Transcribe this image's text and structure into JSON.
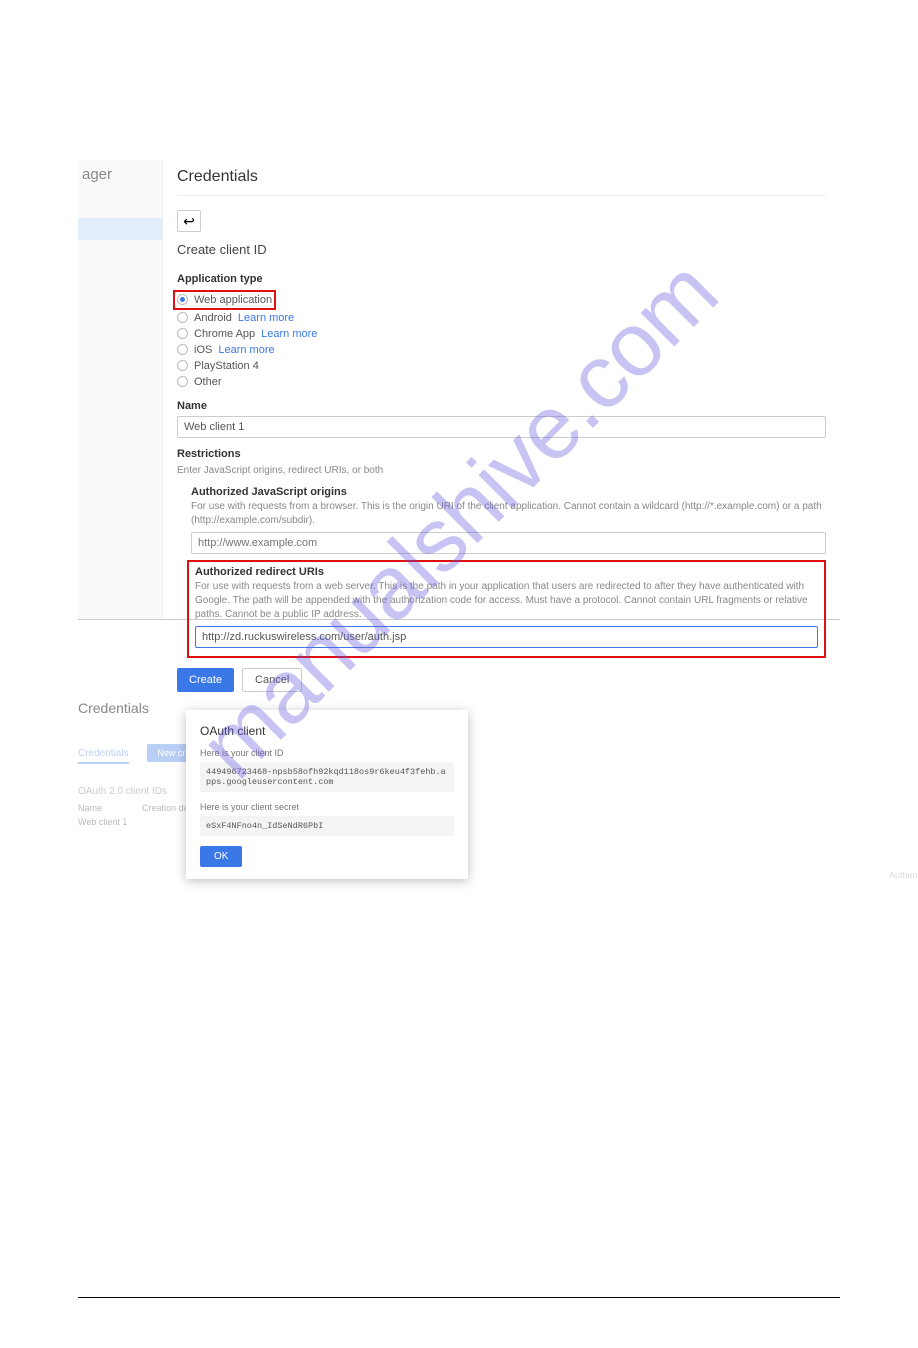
{
  "watermark": "manualshive.com",
  "shot1": {
    "sidebar_fragment": "ager",
    "header": "Credentials",
    "form_title": "Create client ID",
    "app_type_label": "Application type",
    "options": [
      {
        "label": "Web application",
        "checked": true,
        "learn_more": ""
      },
      {
        "label": "Android",
        "checked": false,
        "learn_more": "Learn more"
      },
      {
        "label": "Chrome App",
        "checked": false,
        "learn_more": "Learn more"
      },
      {
        "label": "iOS",
        "checked": false,
        "learn_more": "Learn more"
      },
      {
        "label": "PlayStation 4",
        "checked": false,
        "learn_more": ""
      },
      {
        "label": "Other",
        "checked": false,
        "learn_more": ""
      }
    ],
    "name_label": "Name",
    "name_value": "Web client 1",
    "restrictions_label": "Restrictions",
    "restrictions_helper": "Enter JavaScript origins, redirect URIs, or both",
    "js_origins": {
      "label": "Authorized JavaScript origins",
      "helper": "For use with requests from a browser. This is the origin URI of the client application. Cannot contain a wildcard (http://*.example.com) or a path (http://example.com/subdir).",
      "placeholder": "http://www.example.com"
    },
    "redirect": {
      "label": "Authorized redirect URIs",
      "helper": "For use with requests from a web server. This is the path in your application that users are redirected to after they have authenticated with Google. The path will be appended with the authorization code for access. Must have a protocol. Cannot contain URL fragments or relative paths. Cannot be a public IP address.",
      "value": "http://zd.ruckuswireless.com/user/auth.jsp"
    },
    "create_btn": "Create",
    "cancel_btn": "Cancel"
  },
  "shot2": {
    "header": "Credentials",
    "tab": "Credentials",
    "new_btn": "New credentials",
    "section_tag": "OAuth 2.0 client IDs",
    "col_name": "Name",
    "col_date": "Creation date",
    "row_name": "Web client 1",
    "trailing": "Authentication.jsp",
    "modal": {
      "title": "OAuth client",
      "id_label": "Here is your client ID",
      "id_value": "449496723468-npsb58ofh92kqd118os9r6keu4f3fehb.apps.googleusercontent.com",
      "secret_label": "Here is your client secret",
      "secret_value": "eSxF4NFno4n_IdSeNdR6PbI",
      "ok": "OK"
    }
  }
}
